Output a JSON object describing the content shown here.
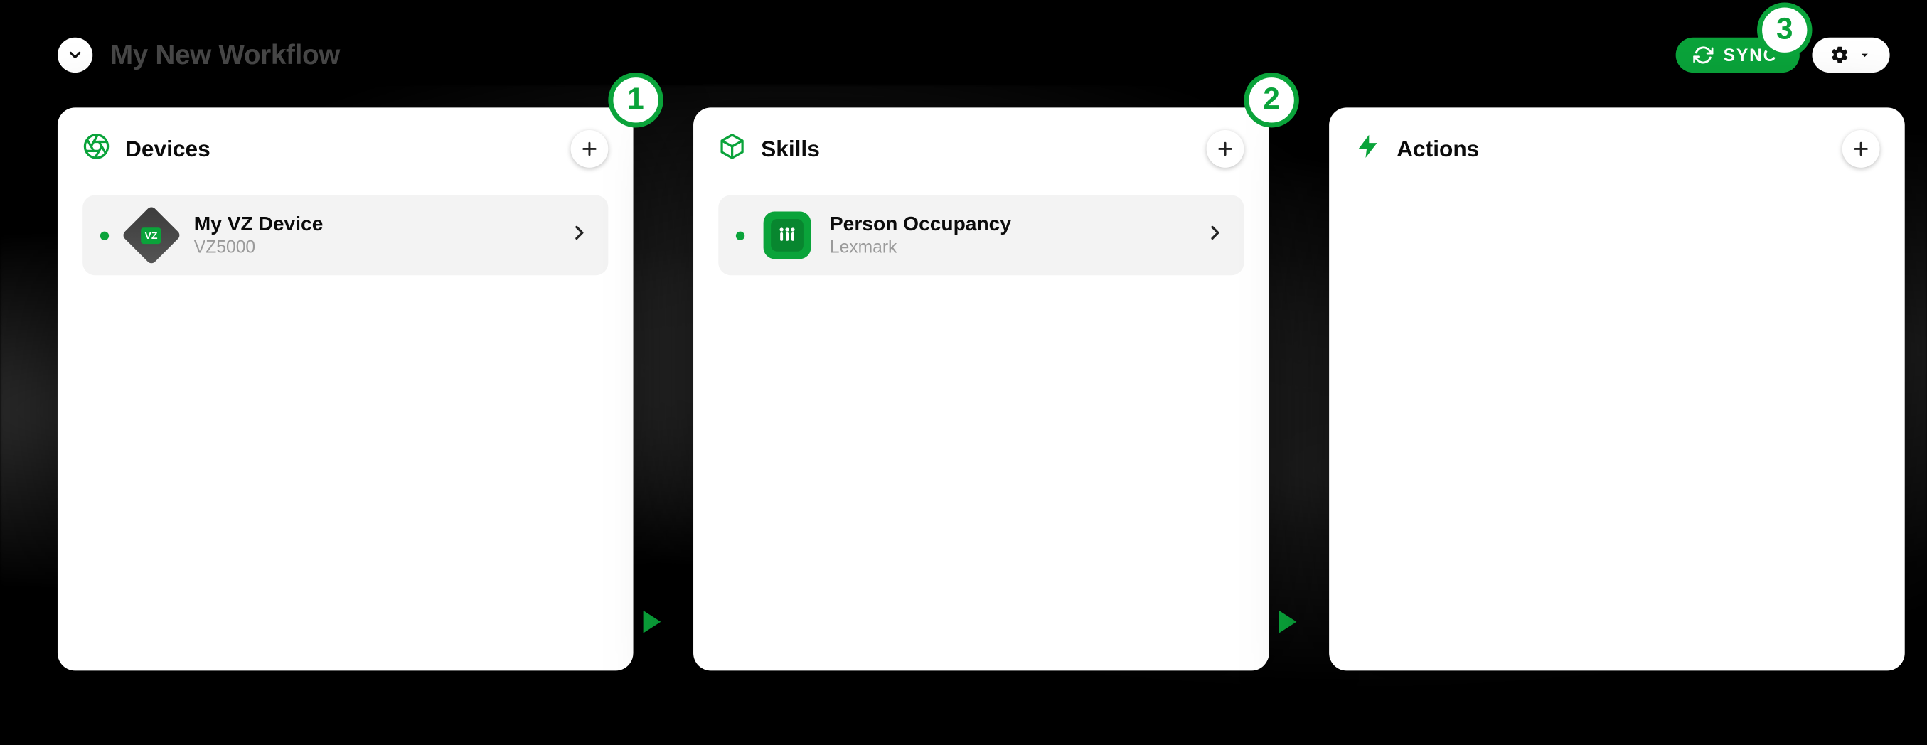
{
  "header": {
    "workflow_title": "My New Workflow",
    "sync_label": "SYNC"
  },
  "badges": {
    "devices": "1",
    "skills": "2",
    "settings": "3"
  },
  "columns": {
    "devices": {
      "title": "Devices",
      "items": [
        {
          "title": "My VZ Device",
          "subtitle": "VZ5000"
        }
      ]
    },
    "skills": {
      "title": "Skills",
      "items": [
        {
          "title": "Person Occupancy",
          "subtitle": "Lexmark"
        }
      ]
    },
    "actions": {
      "title": "Actions",
      "items": []
    }
  },
  "colors": {
    "accent": "#0aa33a"
  }
}
